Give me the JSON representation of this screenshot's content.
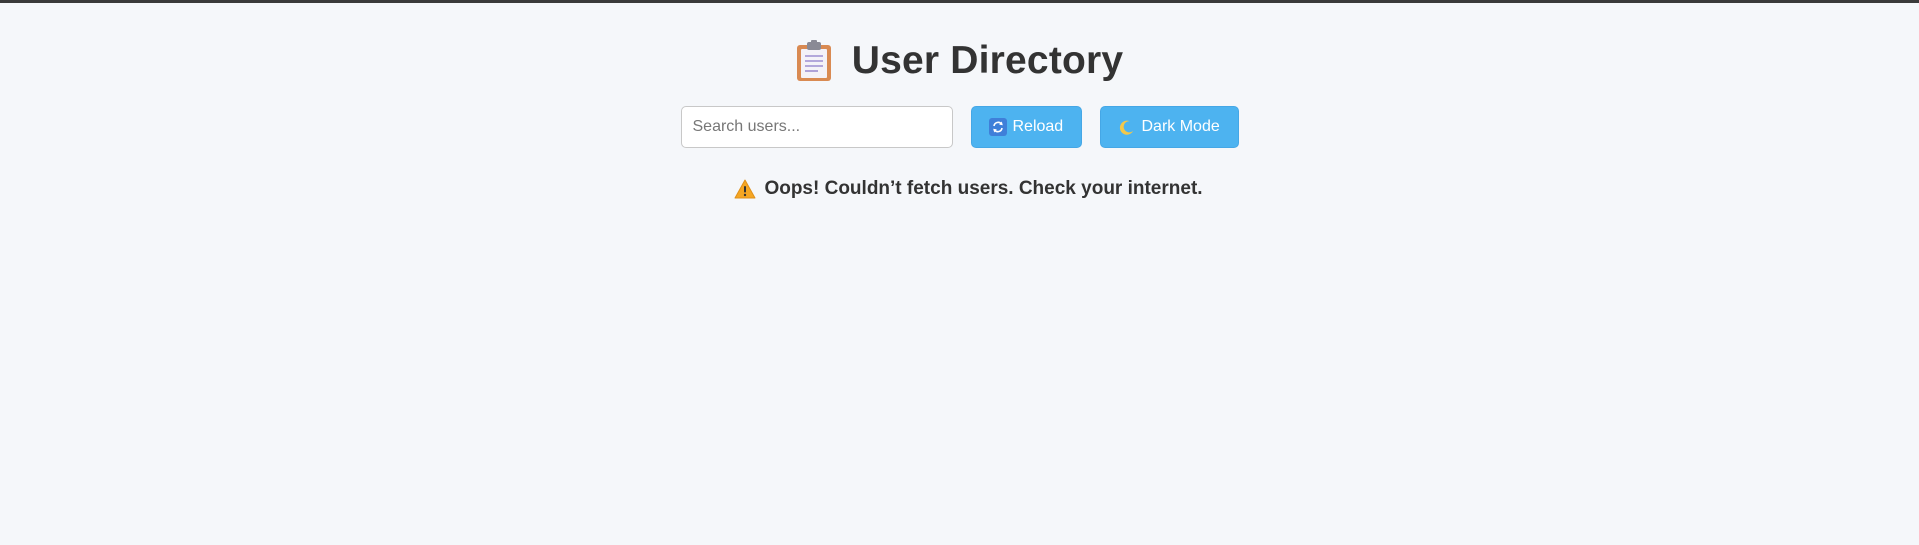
{
  "header": {
    "title": "User Directory",
    "icon": "clipboard-icon"
  },
  "search": {
    "placeholder": "Search users...",
    "value": ""
  },
  "buttons": {
    "reload_label": "Reload",
    "reload_icon": "reload-icon",
    "dark_mode_label": "Dark Mode",
    "dark_mode_icon": "moon-icon"
  },
  "status": {
    "message": "Oops! Couldn’t fetch users. Check your internet.",
    "icon": "warning-icon"
  },
  "colors": {
    "background": "#f5f7fa",
    "button": "#4db3f0",
    "text": "#333333",
    "top_border": "#3a3a3a"
  }
}
